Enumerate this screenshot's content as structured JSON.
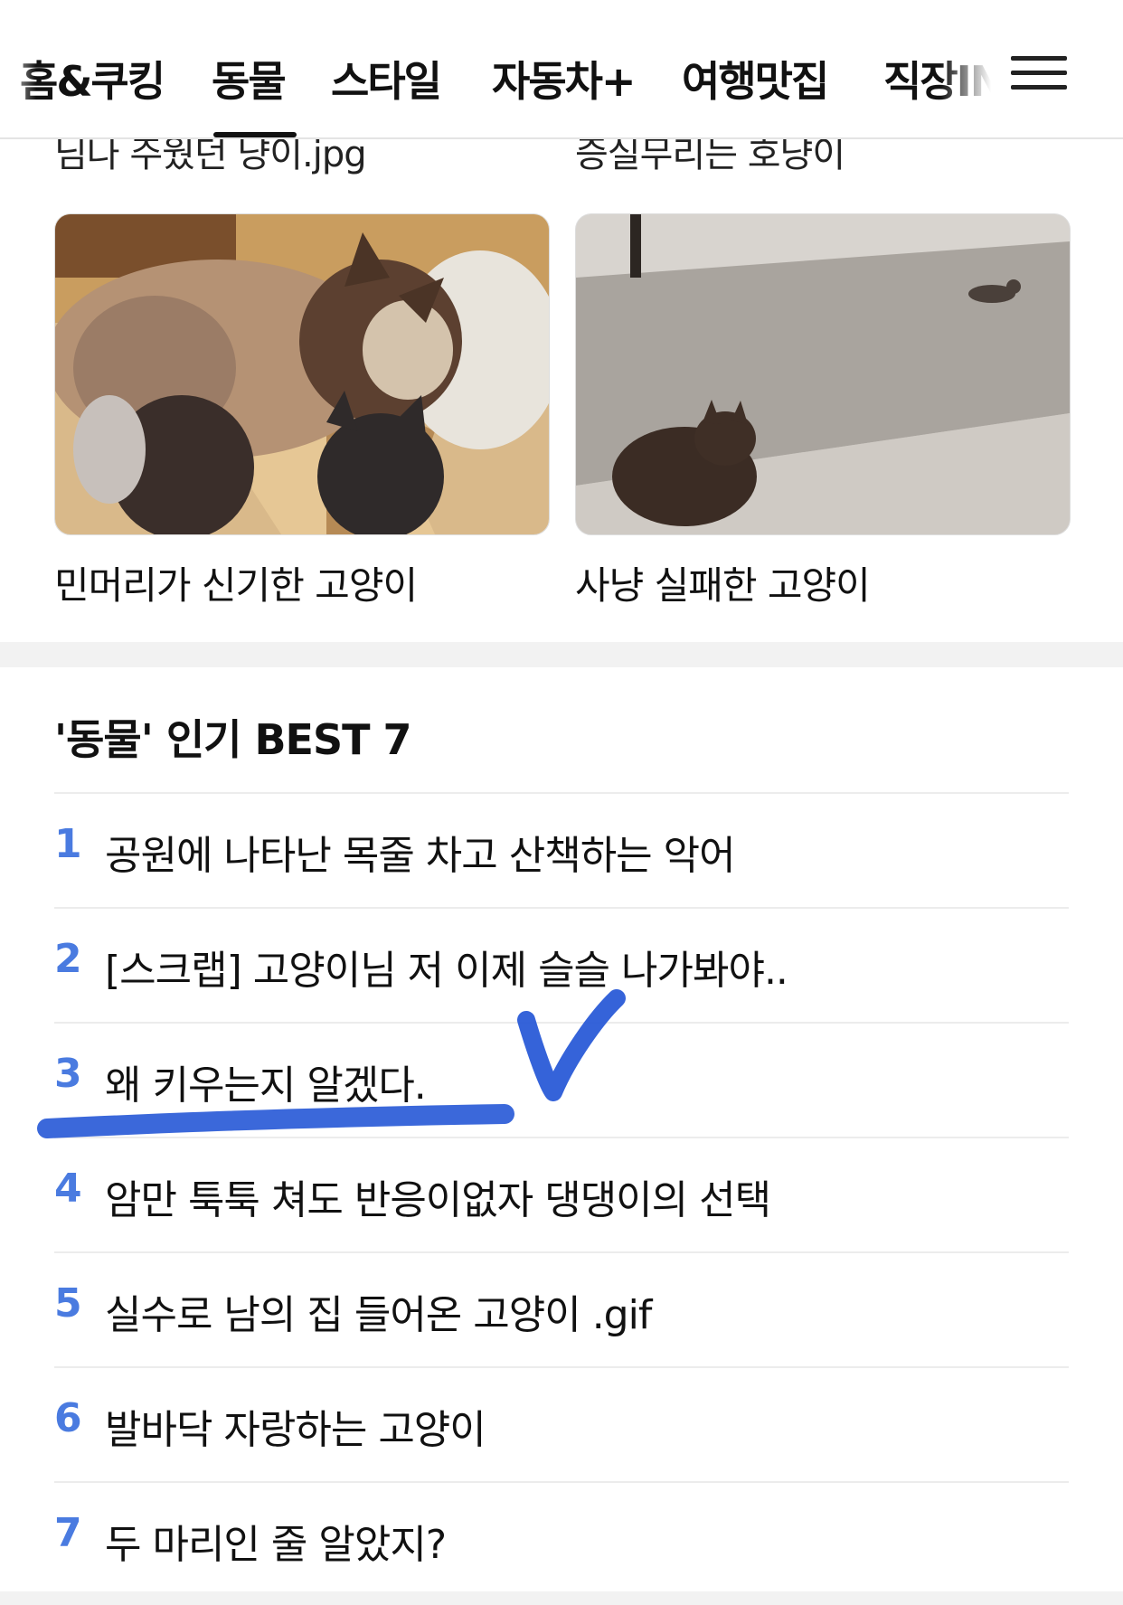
{
  "nav": {
    "tabs": [
      {
        "label": "홈&쿠킹"
      },
      {
        "label": "동물"
      },
      {
        "label": "스타일"
      },
      {
        "label": "자동차+"
      },
      {
        "label": "여행맛집"
      },
      {
        "label": "직장IN"
      }
    ],
    "active_tab": "동물",
    "menu_icon": "hamburger-menu-icon"
  },
  "prev_row": {
    "captions": [
      "님나 주웠던 냥이.jpg",
      "증실무리는 호냥이"
    ]
  },
  "cards": [
    {
      "title": "민머리가 신기한 고양이",
      "thumbnail": "cat-thumbnail-image"
    },
    {
      "title": "사냥 실패한 고양이",
      "thumbnail": "cat-hunting-thumbnail-image"
    }
  ],
  "best": {
    "title": "'동물' 인기 BEST 7",
    "accent_color": "#4a7be0",
    "items": [
      {
        "rank": "1",
        "text": "공원에 나타난 목줄 차고 산책하는 악어"
      },
      {
        "rank": "2",
        "text": "[스크랩] 고양이님 저 이제 슬슬 나가봐야.."
      },
      {
        "rank": "3",
        "text": "왜 키우는지 알겠다."
      },
      {
        "rank": "4",
        "text": "암만 툭툭 쳐도 반응이없자 댕댕이의 선택"
      },
      {
        "rank": "5",
        "text": "실수로 남의 집 들어온 고양이 .gif"
      },
      {
        "rank": "6",
        "text": "발바닥 자랑하는 고양이"
      },
      {
        "rank": "7",
        "text": "두 마리인 줄 알았지?"
      }
    ]
  },
  "annotation": {
    "color": "#2a5bd7",
    "marks": [
      "underline",
      "checkmark"
    ]
  }
}
